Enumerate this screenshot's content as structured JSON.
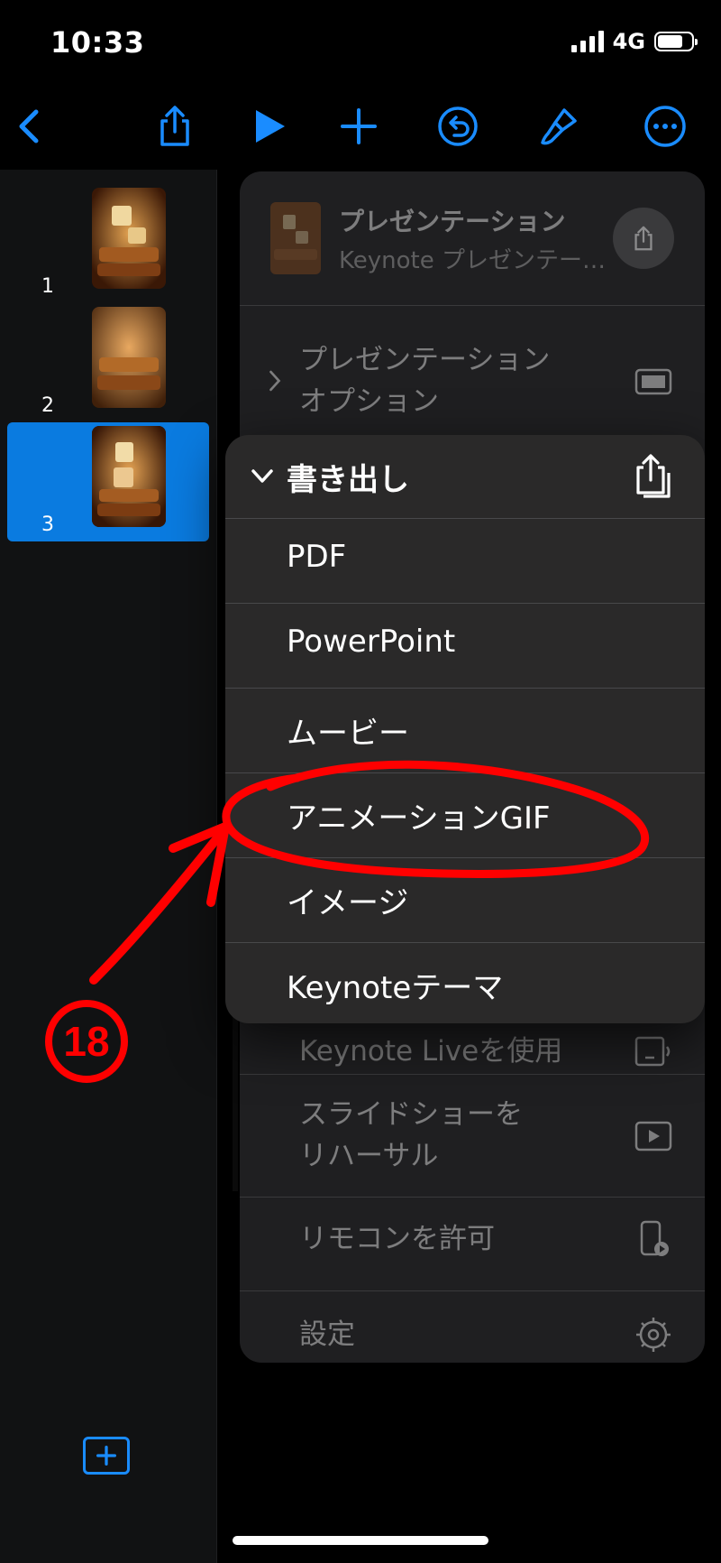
{
  "status": {
    "time": "10:33",
    "network": "4G",
    "battery_level": 0.75
  },
  "toolbar": {
    "icons": [
      "back-chevron-icon",
      "share-icon",
      "play-icon",
      "plus-icon",
      "undo-icon",
      "paintbrush-icon",
      "more-icon"
    ],
    "accent": "#1a8cff"
  },
  "slides": [
    {
      "number": "1",
      "selected": false
    },
    {
      "number": "2",
      "selected": false
    },
    {
      "number": "3",
      "selected": true
    }
  ],
  "document": {
    "title": "プレゼンテーション",
    "subtitle": "Keynote プレゼンテー…"
  },
  "back_menu": {
    "presentation_options": [
      "プレゼンテーション",
      "オプション"
    ],
    "keynote_live": "Keynote Liveを使用",
    "rehearse": [
      "スライドショーを",
      "リハーサル"
    ],
    "remote": "リモコンを許可",
    "settings": "設定"
  },
  "export": {
    "title": "書き出し",
    "options": [
      "PDF",
      "PowerPoint",
      "ムービー",
      "アニメーションGIF",
      "イメージ",
      "Keynoteテーマ"
    ],
    "highlighted": "アニメーションGIF"
  },
  "annotation": {
    "step": "⑱",
    "color": "#ff0000"
  }
}
